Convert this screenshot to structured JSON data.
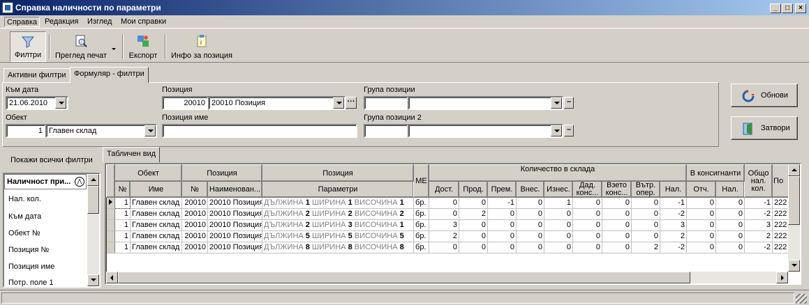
{
  "window": {
    "title": "Справка наличности по параметри"
  },
  "menu": [
    "Справка",
    "Редакция",
    "Изглед",
    "Мои справки"
  ],
  "toolbar": {
    "filters": "Филтри",
    "print_preview": "Преглед печат",
    "export": "Експорт",
    "item_info": "Инфо за позиция"
  },
  "filter_tabs": [
    "Активни филтри",
    "Формуляр - филтри"
  ],
  "form": {
    "to_date_label": "Към дата",
    "to_date_value": "21.06.2010",
    "object_label": "Обект",
    "object_num": "1",
    "object_name": "Главен склад",
    "position_label": "Позиция",
    "position_num": "20010",
    "position_name": "20010 Позиция",
    "position_name_label": "Позиция име",
    "position_name_value": "",
    "group_label": "Група позиции",
    "group2_label": "Група позиции 2"
  },
  "buttons": {
    "refresh": "Обнови",
    "close": "Затвори"
  },
  "left_panel": {
    "show_all": "Покажи всички филтри",
    "header": "Наличност при...",
    "items": [
      "Нал. кол.",
      "Към дата",
      "Обект №",
      "Позиция №",
      "Позиция име",
      "Потр. поле 1"
    ]
  },
  "view_tab": "Табличен вид",
  "grid": {
    "group_headers": {
      "object": "Обект",
      "position": "Позиция",
      "position2": "Позиция",
      "unit": "МЕ",
      "qty": "Количество в склада",
      "consign": "В консигнанти",
      "total": "Общо нал. кол.",
      "more": "По"
    },
    "sub_headers": {
      "obj_no": "№",
      "obj_name": "Име",
      "pos_no": "№",
      "pos_name": "Наименован...",
      "params": "Параметри",
      "dost": "Дост.",
      "prod": "Прод.",
      "prem": "Прем.",
      "vnes": "Внес.",
      "izn": "Изнес.",
      "dad": "Дад. конс...",
      "vzeto": "Взето конс...",
      "vatr": "Вътр. опер.",
      "nal": "Нал.",
      "otch": "Отч.",
      "nal2": "Нал."
    },
    "param_words": {
      "length": "ДЪЛЖИНА",
      "width": "ШИРИНА",
      "height": "ВИСОЧИНА"
    },
    "rows": [
      {
        "obj_no": "1",
        "obj_name": "Главен склад",
        "pos_no": "20010",
        "pos_name": "20010 Позиция",
        "p": [
          "1",
          "1",
          "1"
        ],
        "unit": "бр.",
        "dost": "0",
        "prod": "0",
        "prem": "-1",
        "vnes": "0",
        "izn": "1",
        "dad": "0",
        "vzeto": "0",
        "vatr": "0",
        "nal": "-1",
        "otch": "0",
        "nal2": "0",
        "total": "-1",
        "more": "222"
      },
      {
        "obj_no": "1",
        "obj_name": "Главен склад",
        "pos_no": "20010",
        "pos_name": "20010 Позиция",
        "p": [
          "2",
          "2",
          "2"
        ],
        "unit": "бр.",
        "dost": "0",
        "prod": "2",
        "prem": "0",
        "vnes": "0",
        "izn": "0",
        "dad": "0",
        "vzeto": "0",
        "vatr": "0",
        "nal": "-2",
        "otch": "0",
        "nal2": "0",
        "total": "-2",
        "more": "222"
      },
      {
        "obj_no": "1",
        "obj_name": "Главен склад",
        "pos_no": "20010",
        "pos_name": "20010 Позиция",
        "p": [
          "2",
          "3",
          "1"
        ],
        "unit": "бр.",
        "dost": "3",
        "prod": "0",
        "prem": "0",
        "vnes": "0",
        "izn": "0",
        "dad": "0",
        "vzeto": "0",
        "vatr": "0",
        "nal": "3",
        "otch": "0",
        "nal2": "0",
        "total": "3",
        "more": "222"
      },
      {
        "obj_no": "1",
        "obj_name": "Главен склад",
        "pos_no": "20010",
        "pos_name": "20010 Позиция",
        "p": [
          "5",
          "5",
          "5"
        ],
        "unit": "бр.",
        "dost": "2",
        "prod": "0",
        "prem": "0",
        "vnes": "0",
        "izn": "0",
        "dad": "0",
        "vzeto": "0",
        "vatr": "0",
        "nal": "2",
        "otch": "0",
        "nal2": "0",
        "total": "2",
        "more": "222"
      },
      {
        "obj_no": "1",
        "obj_name": "Главен склад",
        "pos_no": "20010",
        "pos_name": "20010 Позиция",
        "p": [
          "8",
          "8",
          "8"
        ],
        "unit": "бр.",
        "dost": "0",
        "prod": "0",
        "prem": "0",
        "vnes": "0",
        "izn": "0",
        "dad": "0",
        "vzeto": "0",
        "vatr": "2",
        "nal": "-2",
        "otch": "0",
        "nal2": "0",
        "total": "-2",
        "more": "222"
      }
    ]
  }
}
